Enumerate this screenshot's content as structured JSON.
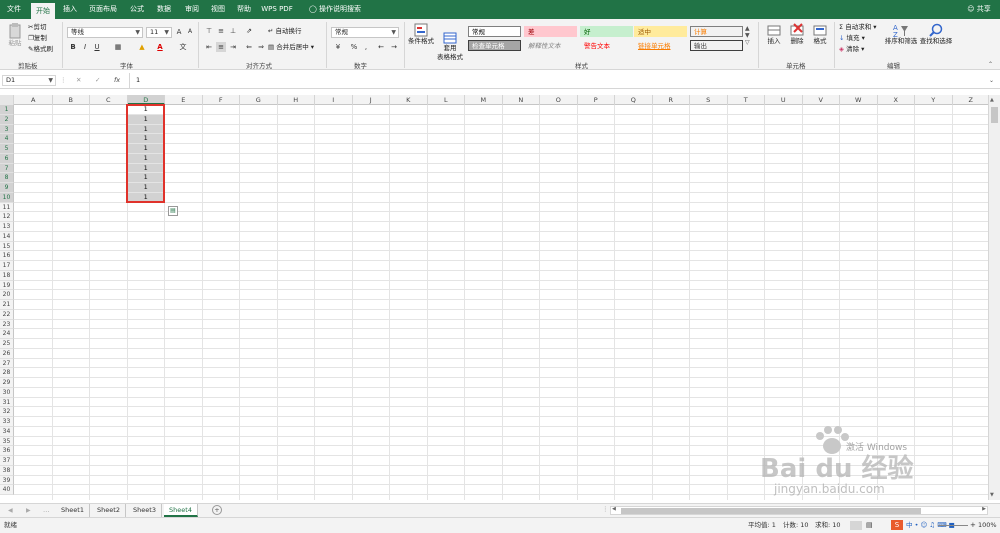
{
  "tabs": [
    "文件",
    "开始",
    "插入",
    "页面布局",
    "公式",
    "数据",
    "审阅",
    "视图",
    "帮助",
    "WPS PDF"
  ],
  "active_tab": "开始",
  "tell_me": "操作说明搜索",
  "share": "共享",
  "clipboard": {
    "paste": "粘贴",
    "cut": "剪切",
    "copy": "复制",
    "format_painter": "格式刷",
    "group": "剪贴板"
  },
  "font": {
    "name": "等线",
    "size": "11",
    "group": "字体",
    "bold": "B",
    "italic": "I",
    "underline": "U",
    "grow": "A",
    "shrink": "A"
  },
  "alignment": {
    "wrap": "自动换行",
    "merge": "合并后居中",
    "group": "对齐方式"
  },
  "number": {
    "format": "常规",
    "group": "数字",
    "percent": "%",
    "comma": ","
  },
  "styles": {
    "cond": "条件格式",
    "table": "套用\n表格格式",
    "group": "样式",
    "items": [
      {
        "label": "常规",
        "bg": "#ffffff",
        "fg": "#000000",
        "border": "#7f7f7f"
      },
      {
        "label": "差",
        "bg": "#ffc7ce",
        "fg": "#9c0006",
        "border": "#ffc7ce"
      },
      {
        "label": "好",
        "bg": "#c6efce",
        "fg": "#006100",
        "border": "#c6efce"
      },
      {
        "label": "适中",
        "bg": "#ffeb9c",
        "fg": "#9c5700",
        "border": "#ffeb9c"
      },
      {
        "label": "计算",
        "bg": "#f2f2f2",
        "fg": "#fa7d00",
        "border": "#7f7f7f"
      },
      {
        "label": "检查单元格",
        "bg": "#a5a5a5",
        "fg": "#ffffff",
        "border": "#3f3f3f"
      },
      {
        "label": "解释性文本",
        "bg": "#f3f3f3",
        "fg": "#7f7f7f",
        "border": "#f3f3f3"
      },
      {
        "label": "警告文本",
        "bg": "#f3f3f3",
        "fg": "#ff0000",
        "border": "#f3f3f3"
      },
      {
        "label": "链接单元格",
        "bg": "#f3f3f3",
        "fg": "#fa7d00",
        "border": "#f3f3f3"
      },
      {
        "label": "输出",
        "bg": "#f2f2f2",
        "fg": "#3f3f3f",
        "border": "#3f3f3f"
      }
    ]
  },
  "cells_group": {
    "insert": "插入",
    "delete": "删除",
    "format": "格式",
    "group": "单元格"
  },
  "editing": {
    "autosum": "自动求和",
    "fill": "填充",
    "clear": "清除",
    "sort": "排序和筛选",
    "find": "查找和选择",
    "group": "编辑"
  },
  "formula_bar": {
    "name_box": "D1",
    "fx": "fx",
    "value": "1"
  },
  "columns": [
    "A",
    "B",
    "C",
    "D",
    "E",
    "F",
    "G",
    "H",
    "I",
    "J",
    "K",
    "L",
    "M",
    "N",
    "O",
    "P",
    "Q",
    "R",
    "S",
    "T",
    "U",
    "V",
    "W",
    "X",
    "Y",
    "Z"
  ],
  "row_count": 40,
  "column_d_values": [
    "1",
    "1",
    "1",
    "1",
    "1",
    "1",
    "1",
    "1",
    "1",
    "1"
  ],
  "sheets": [
    "Sheet1",
    "Sheet2",
    "Sheet3",
    "Sheet4"
  ],
  "active_sheet": "Sheet4",
  "status": {
    "ready": "就绪",
    "average": "平均值: 1",
    "count": "计数: 10",
    "sum": "求和: 10",
    "zoom": "100%"
  },
  "watermark": {
    "brand": "Bai du 经验",
    "url": "jingyan.baidu.com",
    "windows": "激活 Windows"
  },
  "colors": {
    "accent": "#217346",
    "selection": "#d2d2d2",
    "border_sel": "#e0322b"
  }
}
